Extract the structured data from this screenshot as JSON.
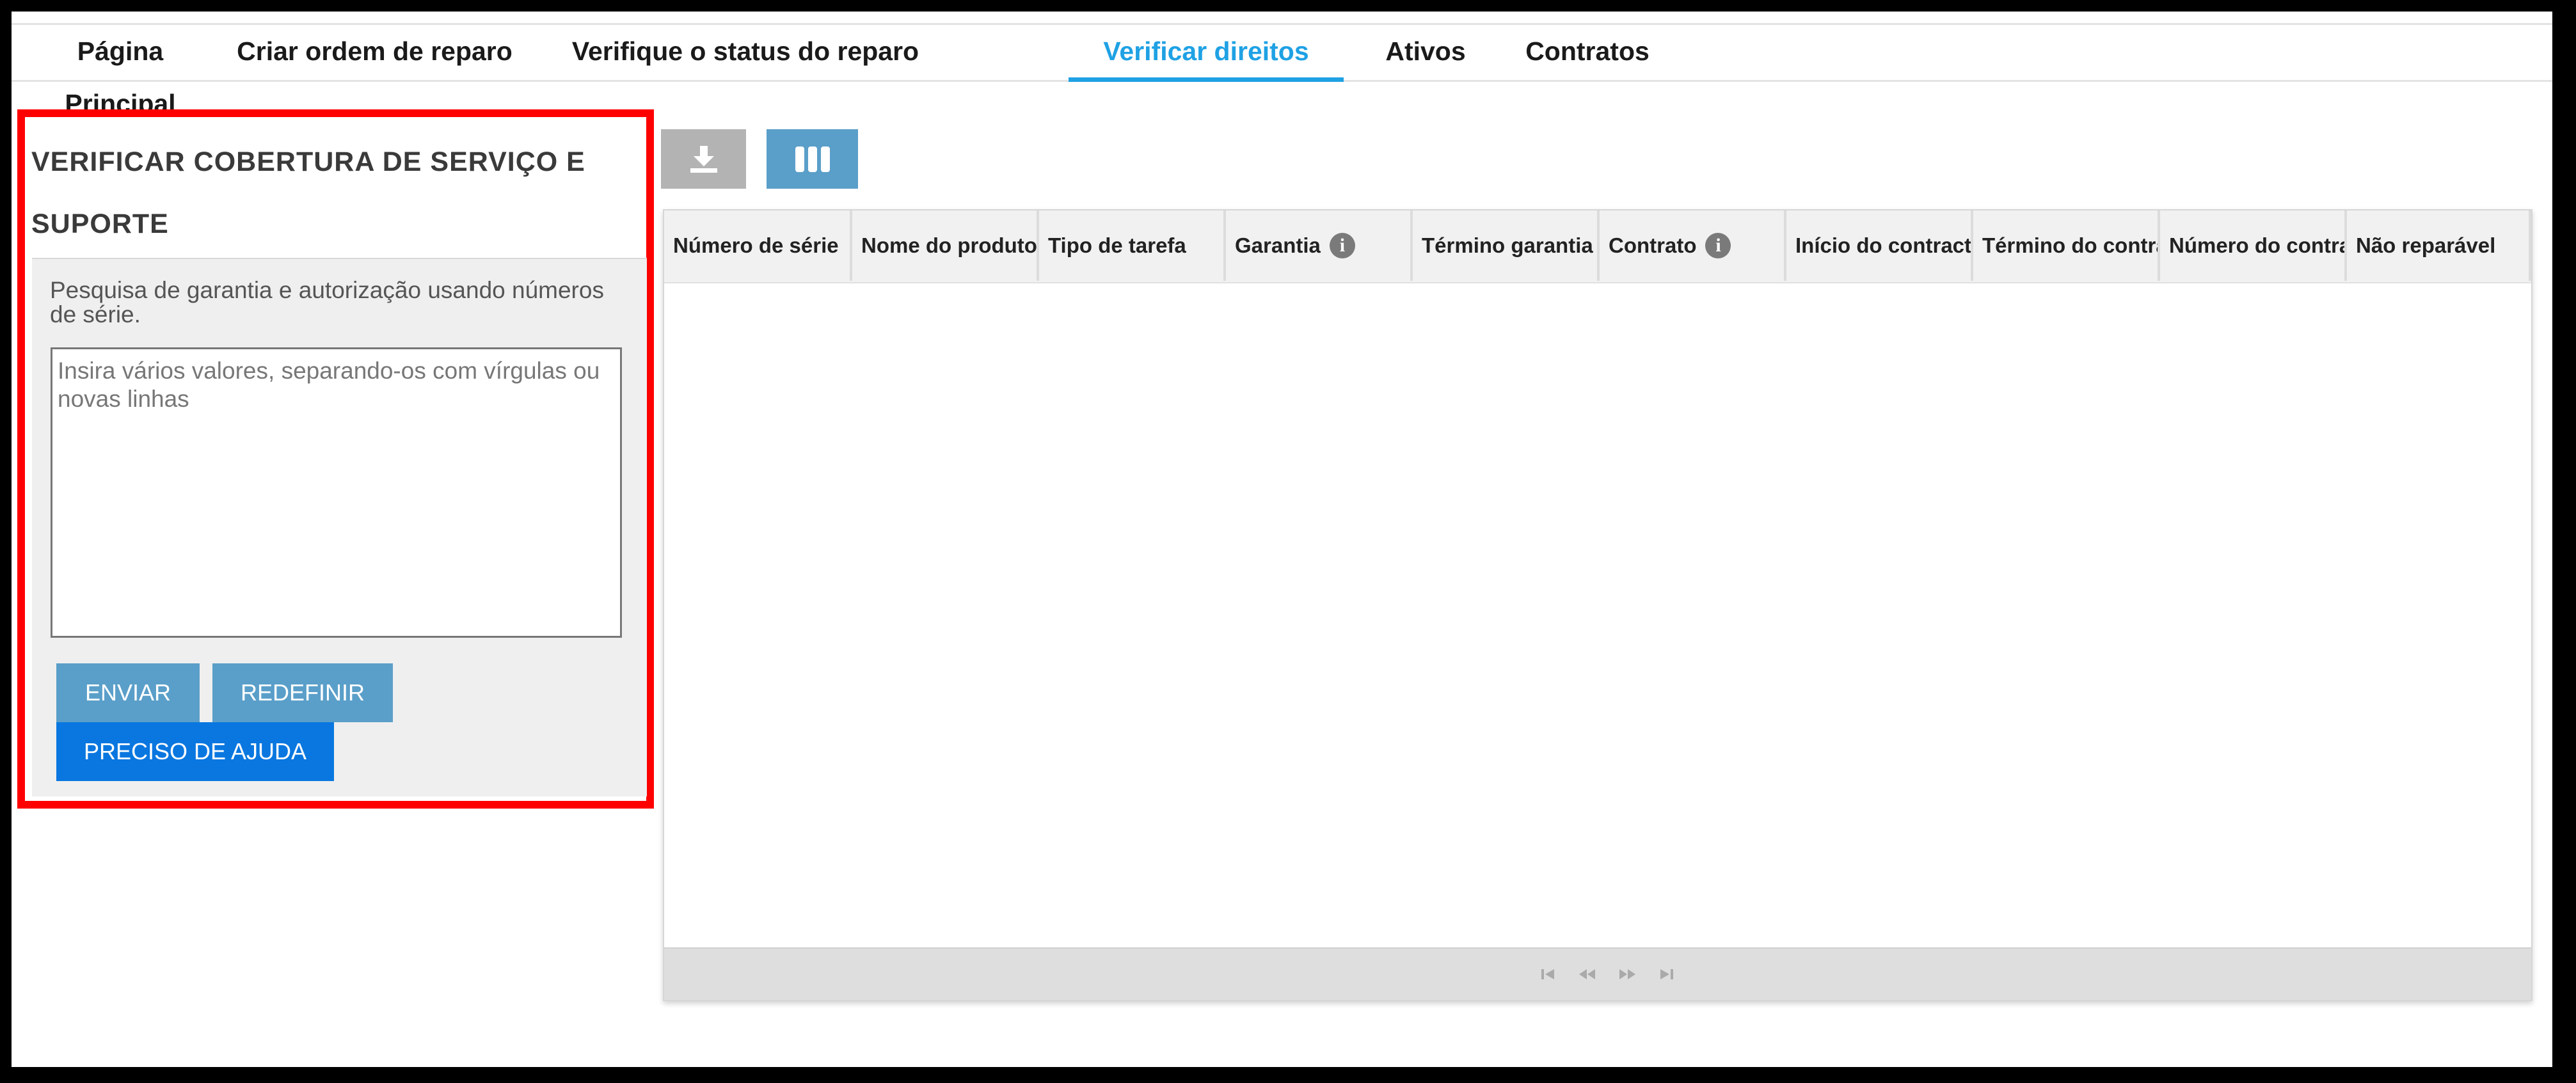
{
  "nav": {
    "tabs": [
      {
        "label": "Página Principal",
        "active": false
      },
      {
        "label": "Criar ordem de reparo",
        "active": false
      },
      {
        "label": "Verifique o status do reparo",
        "active": false
      },
      {
        "label": "Verificar direitos",
        "active": true
      },
      {
        "label": "Ativos",
        "active": false
      },
      {
        "label": "Contratos",
        "active": false
      }
    ]
  },
  "panel": {
    "title": "VERIFICAR COBERTURA DE SERVIÇO E SUPORTE",
    "description": "Pesquisa de garantia e autorização usando números de série.",
    "input_value": "",
    "input_placeholder": "Insira vários valores, separando-os com vírgulas ou novas linhas",
    "submit_label": "ENVIAR",
    "reset_label": "REDEFINIR",
    "help_label": "PRECISO DE AJUDA"
  },
  "toolbar": {
    "download_icon": "download-icon",
    "columns_icon": "columns-icon"
  },
  "grid": {
    "columns": [
      {
        "label": "Número de série",
        "info": false
      },
      {
        "label": "Nome do produto",
        "info": false
      },
      {
        "label": "Tipo de tarefa",
        "info": false
      },
      {
        "label": "Garantia",
        "info": true
      },
      {
        "label": "Término garantia",
        "info": false
      },
      {
        "label": "Contrato",
        "info": true
      },
      {
        "label": "Início do contract",
        "info": false
      },
      {
        "label": "Término do contrato",
        "info": false
      },
      {
        "label": "Número do contrato",
        "info": false
      },
      {
        "label": "Não reparável",
        "info": false
      }
    ],
    "rows": [],
    "pager_icons": [
      "first-page-icon",
      "previous-page-icon",
      "next-page-icon",
      "last-page-icon"
    ]
  },
  "colors": {
    "accent": "#1fa1e4",
    "button": "#5a9fc9",
    "help_button": "#0a77e0",
    "highlight_border": "#ff0000"
  }
}
